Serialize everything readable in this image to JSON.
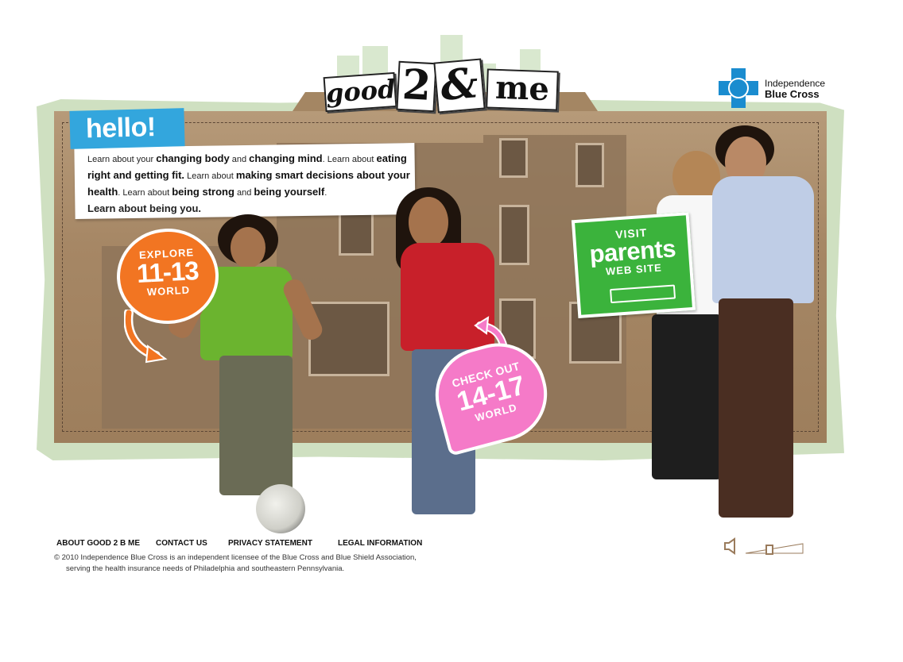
{
  "logo": {
    "good": "good",
    "two": "2",
    "amp": "&",
    "me": "me"
  },
  "brand": {
    "line1": "Independence",
    "line2": "Blue Cross"
  },
  "hello": {
    "title": "hello!",
    "intro": [
      {
        "t": "Learn about your ",
        "b": false
      },
      {
        "t": "changing body",
        "b": true
      },
      {
        "t": " and ",
        "b": false
      },
      {
        "t": "changing mind",
        "b": true
      },
      {
        "t": ". Learn about ",
        "b": false
      },
      {
        "t": "eating right and getting fit.",
        "b": true
      },
      {
        "t": " Learn about ",
        "b": false
      },
      {
        "t": "making smart decisions about your health",
        "b": true
      },
      {
        "t": ". Learn about ",
        "b": false
      },
      {
        "t": "being strong",
        "b": true
      },
      {
        "t": " and ",
        "b": false
      },
      {
        "t": "being yourself",
        "b": true
      },
      {
        "t": ".",
        "b": false
      }
    ],
    "closing": "Learn about being you."
  },
  "explore": {
    "line1": "EXPLORE",
    "line2": "11-13",
    "line3": "WORLD"
  },
  "checkout": {
    "line1": "CHECK OUT",
    "line2": "14-17",
    "line3": "WORLD"
  },
  "parents": {
    "line1": "VISIT",
    "line2": "parents",
    "line3": "WEB SITE"
  },
  "footer": {
    "links": [
      "ABOUT GOOD 2 B ME",
      "CONTACT US",
      "PRIVACY STATEMENT",
      "LEGAL INFORMATION"
    ],
    "copyright_line1": "© 2010 Independence Blue Cross is an independent licensee of the Blue Cross and Blue Shield Association,",
    "copyright_line2": "serving the health insurance needs of Philadelphia and southeastern Pennsylvania."
  },
  "icons": {
    "speaker": "speaker-icon",
    "volume": "volume-slider"
  },
  "colors": {
    "hello_blue": "#33a6dd",
    "explore_orange": "#f27522",
    "checkout_pink": "#f57ac8",
    "parents_green": "#3bb33c",
    "ibc_blue": "#1a8ccf"
  }
}
